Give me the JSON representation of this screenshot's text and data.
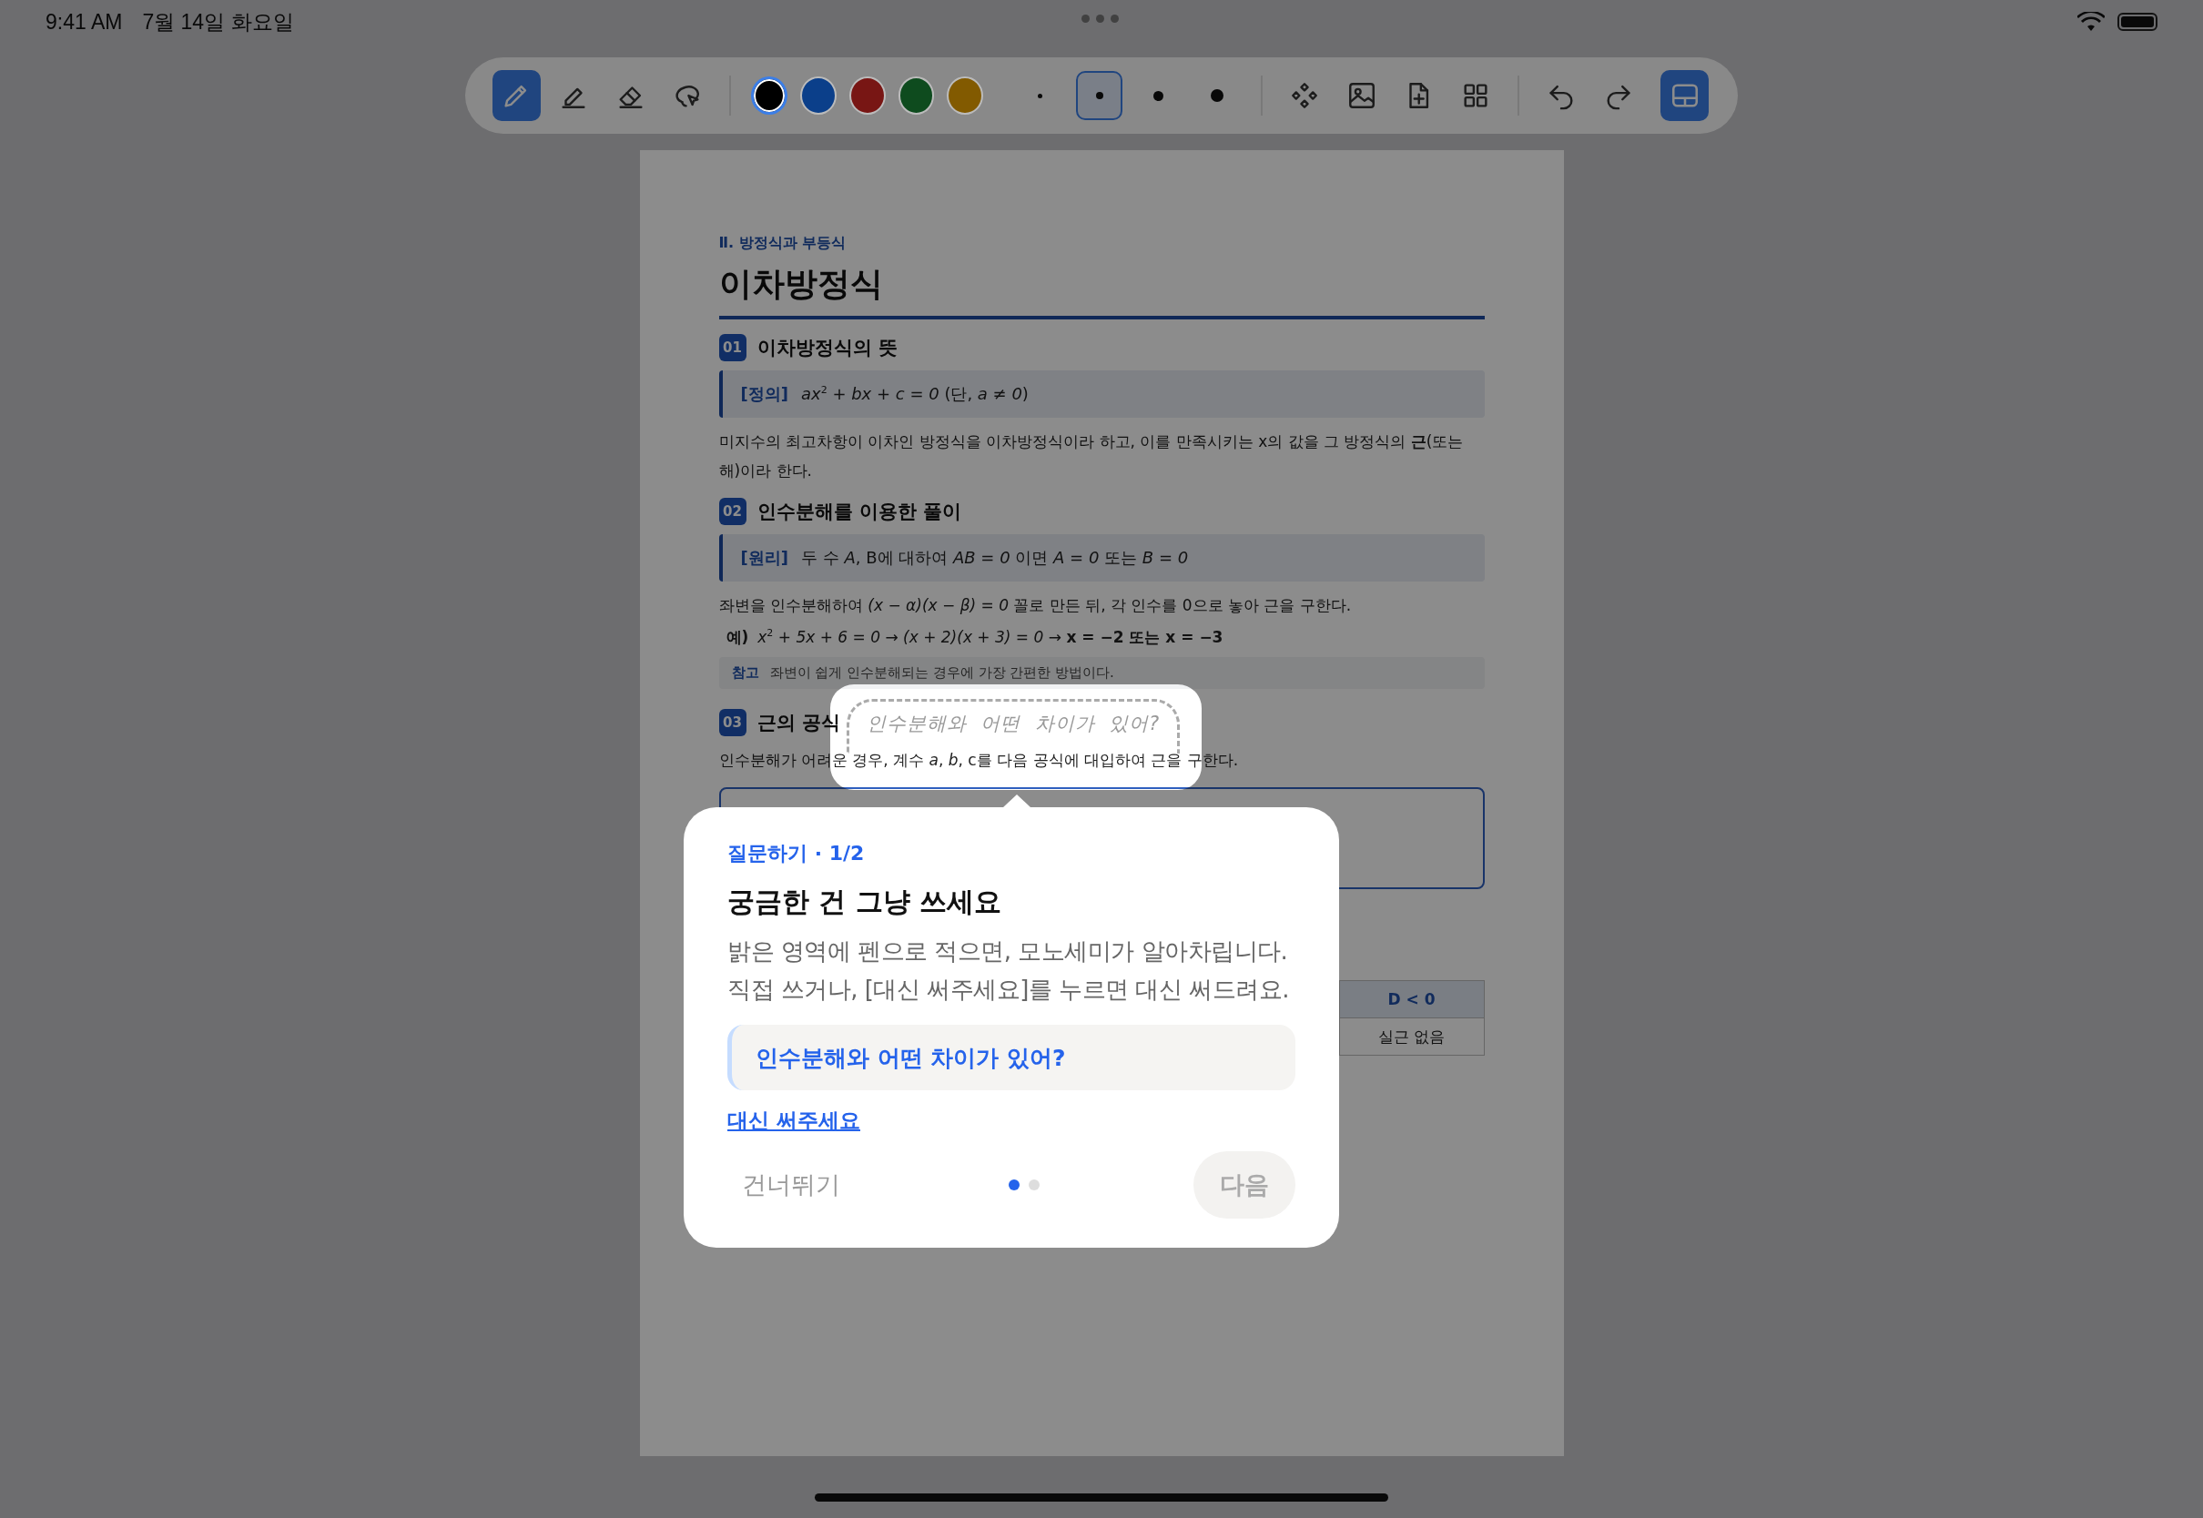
{
  "status_bar": {
    "time": "9:41 AM",
    "date": "7월 14일 화요일"
  },
  "toolbar": {
    "tools": [
      {
        "kind": "pen",
        "selected": true
      },
      {
        "kind": "highlighter",
        "selected": false
      },
      {
        "kind": "eraser",
        "selected": false
      },
      {
        "kind": "lasso",
        "selected": false
      }
    ],
    "colors": [
      {
        "color": "#000000",
        "selected": true
      },
      {
        "color": "#0b3f8a",
        "selected": false
      },
      {
        "color": "#781614",
        "selected": false
      },
      {
        "color": "#0e4b1e",
        "selected": false
      },
      {
        "color": "#825a00",
        "selected": false
      }
    ],
    "sizes": [
      {
        "kind": "xs",
        "selected": false
      },
      {
        "kind": "s",
        "selected": true
      },
      {
        "kind": "m",
        "selected": false
      },
      {
        "kind": "l",
        "selected": false
      }
    ],
    "actions": [
      {
        "kind": "shapes"
      },
      {
        "kind": "image"
      },
      {
        "kind": "add-page"
      },
      {
        "kind": "grid"
      }
    ],
    "history": [
      {
        "kind": "undo"
      },
      {
        "kind": "redo"
      }
    ],
    "panel_toggle": {
      "on": true
    }
  },
  "document": {
    "chapter": "Ⅱ. 방정식과 부등식",
    "title": "이차방정식",
    "blocks": [
      {
        "kind": "heading",
        "number": "01",
        "text": "이차방정식의 뜻"
      },
      {
        "kind": "box",
        "label": "[정의]",
        "body": "*ax*$^{2}$ *+ bx + c = 0*  (단, *a ≠ 0*)"
      },
      {
        "kind": "paragraph",
        "text": "미지수의 최고차항이 이차인 방정식을 이차방정식이라 하고, 이를 만족시키는 x의 값을 그 방정식의 **근**(또는 해)이라 한다."
      },
      {
        "kind": "heading",
        "number": "02",
        "text": "인수분해를 이용한 풀이"
      },
      {
        "kind": "box",
        "label": "[원리]",
        "body": "두 수 *A*, B에 대하여  *AB = 0*  이면  *A = 0* 또는 *B = 0*"
      },
      {
        "kind": "paragraph",
        "text": "좌변을 인수분해하여 *(x − α)(x − β) = 0* 꼴로 만든 뒤, 각 인수를 0으로 놓아 근을 구한다."
      },
      {
        "kind": "example",
        "label": "예)",
        "body": "*x*$^{2}$ *+ 5x + 6 = 0 → (x + 2)(x + 3) = 0 →* **x = −2 또는 x = −3**"
      },
      {
        "kind": "note",
        "label": "참고",
        "text": "좌변이 쉽게 인수분해되는 경우에 가장 간편한 방법이다."
      },
      {
        "kind": "heading",
        "number": "03",
        "text": "근의 공식"
      },
      {
        "kind": "paragraph",
        "text": "인수분해가 어려운 경우, 계수 *a*, *b*, c를 다음 공식에 대입하여 근을 구한다."
      },
      {
        "kind": "formula_box"
      },
      {
        "kind": "table",
        "header": "D < 0",
        "cell": "실근 없음"
      }
    ]
  },
  "handwriting": {
    "text": "인수분해와  어떤  차이가  있어?"
  },
  "popup": {
    "step": "질문하기 · 1/2",
    "title": "궁금한 건 그냥 쓰세요",
    "body_lines": [
      "밝은 영역에 펜으로 적으면, 모노세미가 알아차립니다.",
      "직접 쓰거나, [대신 써주세요]를 누르면 대신 써드려요."
    ],
    "quote": "인수분해와 어떤 차이가 있어?",
    "link": "대신 써주세요",
    "skip": "건너뛰기",
    "dots": [
      {
        "selected": true
      },
      {
        "selected": false
      }
    ],
    "next": {
      "label": "다음",
      "disabled": true
    }
  }
}
